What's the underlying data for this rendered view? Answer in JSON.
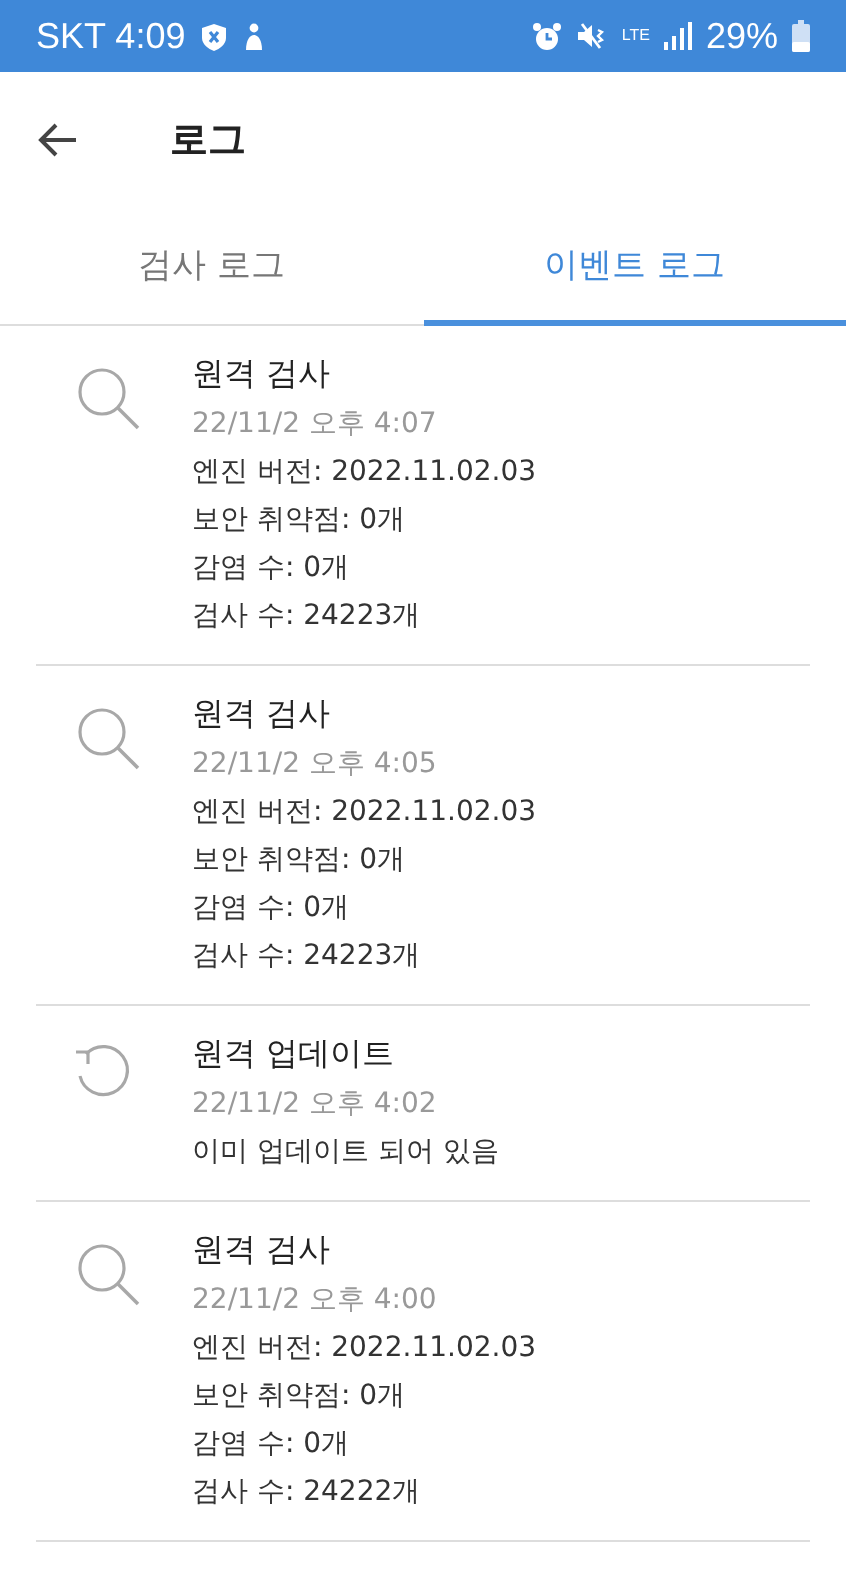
{
  "status_bar": {
    "carrier_time": "SKT 4:09",
    "network": "LTE",
    "battery": "29%"
  },
  "header": {
    "title": "로그"
  },
  "tabs": [
    {
      "label": "검사 로그",
      "selected": false
    },
    {
      "label": "이벤트 로그",
      "selected": true
    }
  ],
  "entries": [
    {
      "kind": "scan",
      "title": "원격 검사",
      "date": "22/11/2 오후 4:07",
      "lines": [
        "엔진 버전: 2022.11.02.03",
        "보안 취약점: 0개",
        "감염 수: 0개",
        "검사 수: 24223개"
      ]
    },
    {
      "kind": "scan",
      "title": "원격 검사",
      "date": "22/11/2 오후 4:05",
      "lines": [
        "엔진 버전: 2022.11.02.03",
        "보안 취약점: 0개",
        "감염 수: 0개",
        "검사 수: 24223개"
      ]
    },
    {
      "kind": "update",
      "title": "원격 업데이트",
      "date": "22/11/2 오후 4:02",
      "lines": [
        "이미 업데이트 되어 있음"
      ]
    },
    {
      "kind": "scan",
      "title": "원격 검사",
      "date": "22/11/2 오후 4:00",
      "lines": [
        "엔진 버전: 2022.11.02.03",
        "보안 취약점: 0개",
        "감염 수: 0개",
        "검사 수: 24222개"
      ]
    }
  ]
}
